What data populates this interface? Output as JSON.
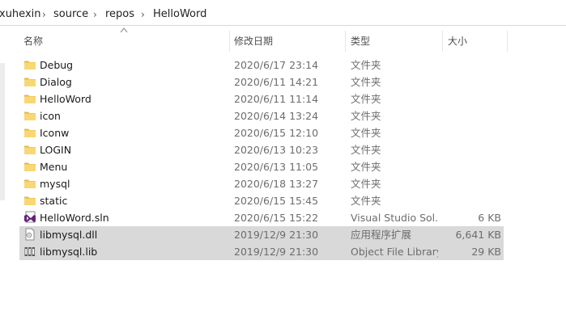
{
  "breadcrumb": {
    "items": [
      "xuhexin",
      "source",
      "repos",
      "HelloWord"
    ],
    "separator": "›"
  },
  "columns": {
    "name": "名称",
    "date": "修改日期",
    "type": "类型",
    "size": "大小"
  },
  "files": [
    {
      "name": "Debug",
      "date": "2020/6/17 23:14",
      "type": "文件夹",
      "size": "",
      "icon": "folder-icon",
      "selected": false
    },
    {
      "name": "Dialog",
      "date": "2020/6/11 14:21",
      "type": "文件夹",
      "size": "",
      "icon": "folder-icon",
      "selected": false
    },
    {
      "name": "HelloWord",
      "date": "2020/6/11 11:14",
      "type": "文件夹",
      "size": "",
      "icon": "folder-icon",
      "selected": false
    },
    {
      "name": "icon",
      "date": "2020/6/14 13:24",
      "type": "文件夹",
      "size": "",
      "icon": "folder-icon",
      "selected": false
    },
    {
      "name": "Iconw",
      "date": "2020/6/15 12:10",
      "type": "文件夹",
      "size": "",
      "icon": "folder-icon",
      "selected": false
    },
    {
      "name": "LOGIN",
      "date": "2020/6/13 10:23",
      "type": "文件夹",
      "size": "",
      "icon": "folder-icon",
      "selected": false
    },
    {
      "name": "Menu",
      "date": "2020/6/13 11:05",
      "type": "文件夹",
      "size": "",
      "icon": "folder-icon",
      "selected": false
    },
    {
      "name": "mysql",
      "date": "2020/6/18 13:27",
      "type": "文件夹",
      "size": "",
      "icon": "folder-icon",
      "selected": false
    },
    {
      "name": "static",
      "date": "2020/6/15 15:45",
      "type": "文件夹",
      "size": "",
      "icon": "folder-icon",
      "selected": false
    },
    {
      "name": "HelloWord.sln",
      "date": "2020/6/15 15:22",
      "type": "Visual Studio Sol...",
      "size": "6 KB",
      "icon": "visual-studio-solution-icon",
      "selected": false
    },
    {
      "name": "libmysql.dll",
      "date": "2019/12/9 21:30",
      "type": "应用程序扩展",
      "size": "6,641 KB",
      "icon": "dll-file-icon",
      "selected": true
    },
    {
      "name": "libmysql.lib",
      "date": "2019/12/9 21:30",
      "type": "Object File Library",
      "size": "29 KB",
      "icon": "library-file-icon",
      "selected": true
    }
  ],
  "colors": {
    "folder": "#f8d775",
    "folder_dark": "#e6b949",
    "selection": "#d9d9d9",
    "vs_purple": "#68217a"
  }
}
